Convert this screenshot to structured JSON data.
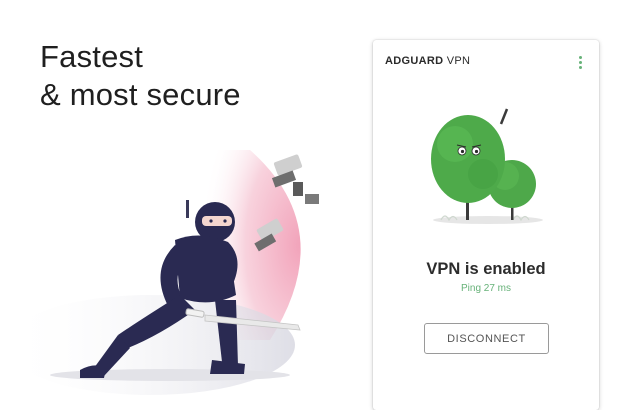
{
  "promo": {
    "headline_line1": "Fastest",
    "headline_line2": "& most secure"
  },
  "app": {
    "brand_bold": "ADGUARD",
    "brand_light": "VPN",
    "menu_icon": "more-vertical-icon",
    "status_title": "VPN is enabled",
    "ping_text": "Ping 27 ms",
    "disconnect_label": "DISCONNECT",
    "accent_color": "#67b279"
  }
}
